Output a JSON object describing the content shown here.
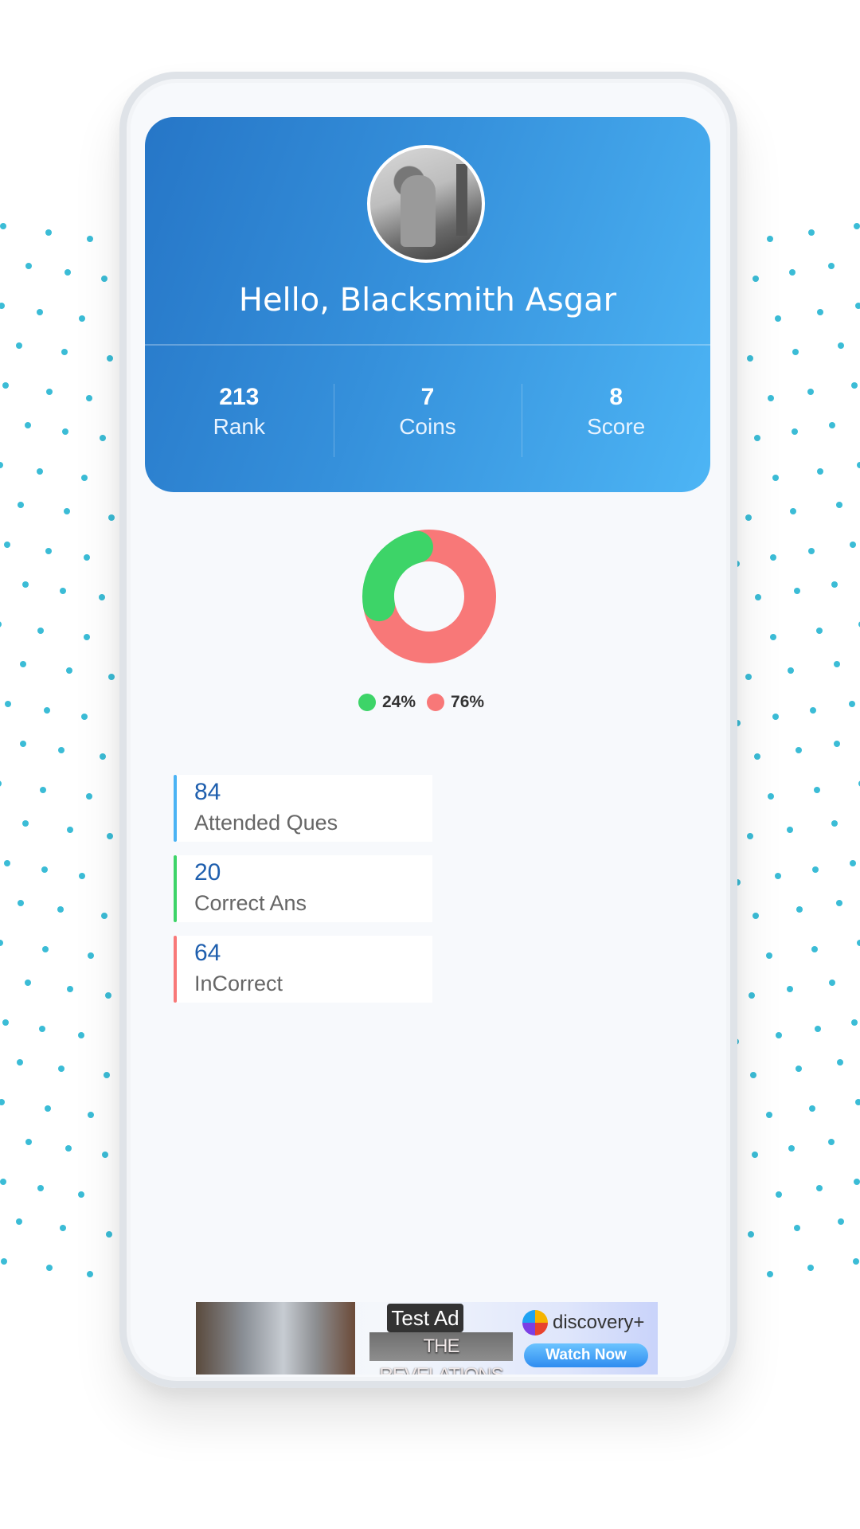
{
  "profile": {
    "greeting": "Hello, Blacksmith Asgar",
    "stats": [
      {
        "value": "213",
        "label": "Rank"
      },
      {
        "value": "7",
        "label": "Coins"
      },
      {
        "value": "8",
        "label": "Score"
      }
    ]
  },
  "chart_data": {
    "type": "pie",
    "variant": "donut",
    "title": "",
    "categories": [
      "Correct",
      "InCorrect"
    ],
    "values": [
      24,
      76
    ],
    "unit": "%",
    "colors": [
      "#3dd468",
      "#f87878"
    ],
    "legend": [
      "24%",
      "76%"
    ],
    "legend_position": "bottom"
  },
  "metrics": [
    {
      "value": "84",
      "label": "Attended Ques",
      "color": "#4ab3f4"
    },
    {
      "value": "20",
      "label": "Correct Ans",
      "color": "#3dd468"
    },
    {
      "value": "64",
      "label": "InCorrect",
      "color": "#f87878"
    }
  ],
  "ad": {
    "badge": "Test Ad",
    "title": "THE REVELATIONS",
    "brand": "discovery+",
    "cta": "Watch Now"
  }
}
